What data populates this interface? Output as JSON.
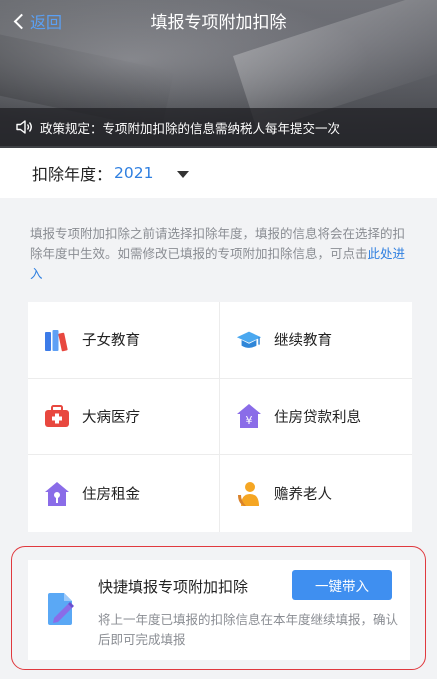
{
  "header": {
    "back_label": "返回",
    "title": "填报专项附加扣除",
    "notice": "政策规定：专项附加扣除的信息需纳税人每年提交一次"
  },
  "year": {
    "label": "扣除年度：",
    "value": "2021"
  },
  "tip": {
    "text": "填报专项附加扣除之前请选择扣除年度，填报的信息将会在选择的扣除年度中生效。如需修改已填报的专项附加扣除信息，可点击",
    "link": "此处进入"
  },
  "grid": {
    "items": [
      {
        "label": "子女教育",
        "icon": "books-icon",
        "color": "#3c7be8"
      },
      {
        "label": "继续教育",
        "icon": "graduation-cap-icon",
        "color": "#4aa8f0"
      },
      {
        "label": "大病医疗",
        "icon": "medical-kit-icon",
        "color": "#e8483f"
      },
      {
        "label": "住房贷款利息",
        "icon": "house-yen-icon",
        "color": "#8a6ce8"
      },
      {
        "label": "住房租金",
        "icon": "house-key-icon",
        "color": "#8a6ce8"
      },
      {
        "label": "赡养老人",
        "icon": "elder-person-icon",
        "color": "#f5a623"
      }
    ]
  },
  "quick": {
    "title": "快捷填报专项附加扣除",
    "button": "一键带入",
    "desc": "将上一年度已填报的扣除信息在本年度继续填报，确认后即可完成填报",
    "icon": "edit-document-icon"
  },
  "colors": {
    "accent": "#2f7fe0",
    "button": "#3f8ff0",
    "highlight_outline": "#e0393e"
  }
}
